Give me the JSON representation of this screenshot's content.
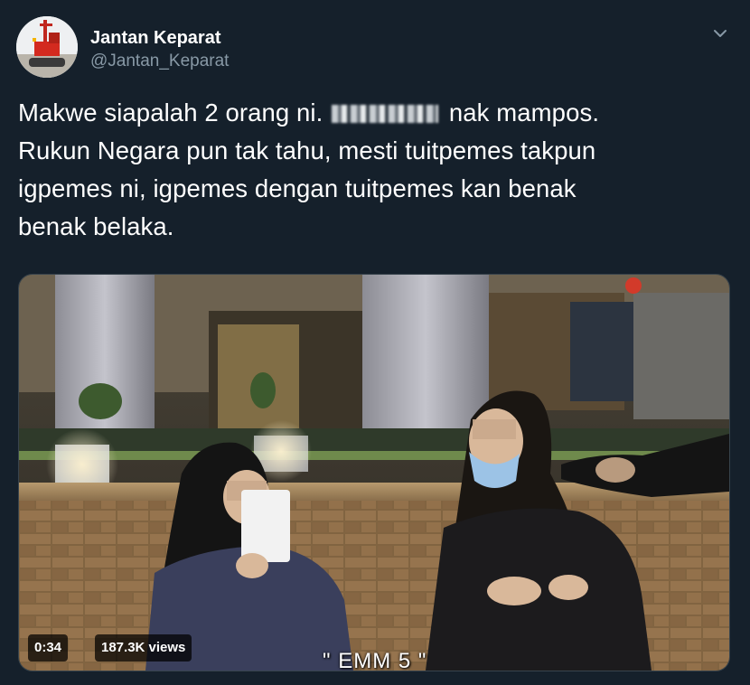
{
  "author": {
    "display_name": "Jantan Keparat",
    "handle": "@Jantan_Keparat",
    "avatar_icon": "excavator-avatar-icon"
  },
  "menu": {
    "icon": "chevron-down-icon"
  },
  "tweet": {
    "line1_before": "Makwe siapalah 2 orang ni.",
    "line1_after": "nak mampos.",
    "line2": "Rukun Negara pun tak tahu, mesti tuitpemes takpun",
    "line3": "igpemes ni, igpemes dengan tuitpemes kan benak",
    "line4": "benak belaka."
  },
  "video": {
    "duration": "0:34",
    "views": "187.3K views",
    "caption": "\" EMM 5 \""
  },
  "colors": {
    "background": "#15202b",
    "text_primary": "#ffffff",
    "text_secondary": "#8899a6",
    "border": "#38444d"
  }
}
